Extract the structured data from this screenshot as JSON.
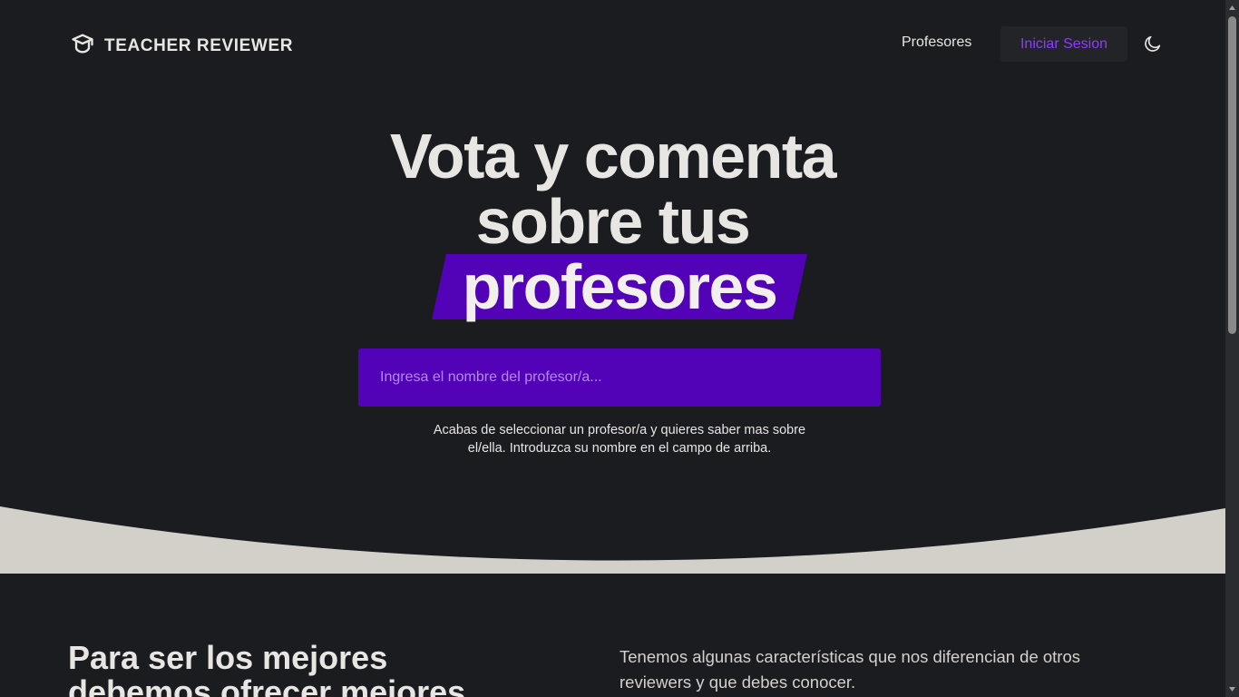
{
  "nav": {
    "brand": "TEACHER REVIEWER",
    "link_professors": "Profesores",
    "login": "Iniciar Sesion"
  },
  "hero": {
    "line1": "Vota y comenta",
    "line2": "sobre tus",
    "highlight": "profesores"
  },
  "search": {
    "placeholder": "Ingresa el nombre del profesor/a...",
    "hint": "Acabas de seleccionar un profesor/a y quieres saber mas sobre el/ella. Introduzca su nombre en el campo de arriba."
  },
  "features": {
    "title": "Para ser los mejores debemos ofrecer mejores",
    "description": "Tenemos algunas características que nos diferencian de otros reviewers y que debes conocer."
  },
  "icons": {
    "brand": "graduation-cap-icon",
    "theme": "moon-icon"
  },
  "colors": {
    "background": "#1b1c1f",
    "accent": "#5203b8",
    "link_accent": "#8b3dff",
    "wave": "#d3d0ca"
  }
}
